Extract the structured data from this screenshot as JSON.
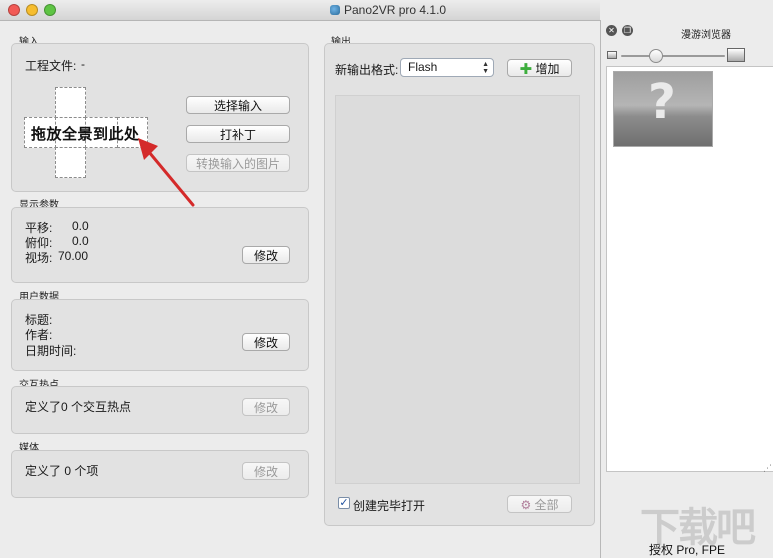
{
  "window": {
    "title": "Pano2VR pro 4.1.0"
  },
  "input": {
    "section_label": "输入",
    "project_file_label": "工程文件:",
    "project_file_value": "-",
    "drop_hint": "拖放全景到此处",
    "select_input_button": "选择输入",
    "patch_button": "打补丁",
    "convert_button": "转换输入的图片"
  },
  "display": {
    "section_label": "显示参数",
    "pan_label": "平移:",
    "pan_value": "0.0",
    "tilt_label": "俯仰:",
    "tilt_value": "0.0",
    "fov_label": "视场:",
    "fov_value": "70.00",
    "modify_button": "修改"
  },
  "user_data": {
    "section_label": "用户数据",
    "title_label": "标题:",
    "author_label": "作者:",
    "datetime_label": "日期时间:",
    "modify_button": "修改"
  },
  "hotspots": {
    "section_label": "交互热点",
    "summary": "定义了0 个交互热点",
    "modify_button": "修改"
  },
  "media": {
    "section_label": "媒体",
    "summary": "定义了 0 个项",
    "modify_button": "修改"
  },
  "output": {
    "section_label": "输出",
    "format_label": "新输出格式:",
    "format_value": "Flash",
    "add_button": "增加",
    "open_after_label": "创建完毕打开",
    "open_after_checked": true,
    "all_button": "全部"
  },
  "tour_browser": {
    "title": "漫游浏览器",
    "thumbnail_glyph": "?"
  },
  "status": {
    "license_text": "授权 Pro, FPE"
  },
  "watermark": {
    "text": "下载吧"
  },
  "colors": {
    "accent_arrow": "#d42a2a",
    "add_icon": "#3dae3d"
  }
}
